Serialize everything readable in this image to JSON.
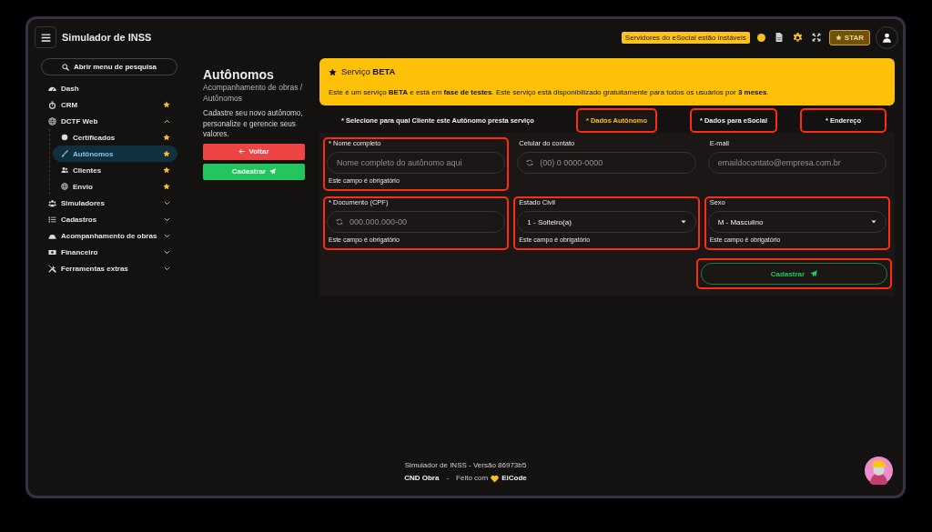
{
  "topbar": {
    "title": "Simulador de INSS",
    "status_message": "Servidores do eSocial estão instáveis",
    "star_button": "STAR"
  },
  "sidebar": {
    "search_button": "Abrir menu de pesquisa",
    "items": [
      {
        "label": "Dash",
        "kind": "link",
        "starred": false,
        "selected": false
      },
      {
        "label": "CRM",
        "kind": "link",
        "starred": true,
        "selected": false
      },
      {
        "label": "DCTF Web",
        "kind": "group",
        "expanded": true,
        "starred": false,
        "selected": false,
        "children": [
          {
            "label": "Certificados",
            "starred": true,
            "selected": false
          },
          {
            "label": "Autônomos",
            "starred": true,
            "selected": true
          },
          {
            "label": "Clientes",
            "starred": true,
            "selected": false
          },
          {
            "label": "Envio",
            "starred": true,
            "selected": false
          }
        ]
      },
      {
        "label": "Simuladores",
        "kind": "group",
        "expanded": false,
        "starred": false,
        "selected": false
      },
      {
        "label": "Cadastros",
        "kind": "group",
        "expanded": false,
        "starred": false,
        "selected": false
      },
      {
        "label": "Acompanhamento de obras",
        "kind": "group",
        "expanded": false,
        "starred": false,
        "selected": false
      },
      {
        "label": "Financeiro",
        "kind": "group",
        "expanded": false,
        "starred": false,
        "selected": false
      },
      {
        "label": "Ferramentas extras",
        "kind": "group",
        "expanded": false,
        "starred": false,
        "selected": false
      }
    ]
  },
  "page_header": {
    "title": "Autônomos",
    "breadcrumb": "Acompanhamento de obras / Autônomos",
    "description": "Cadastre seu novo autônomo, personalize e gerencie seus valores.",
    "buttons": [
      {
        "label": "Voltar",
        "kind": "back"
      },
      {
        "label": "Cadastrar",
        "kind": "submit"
      }
    ]
  },
  "banner": {
    "title": "Serviço **BETA**",
    "text": "Este é um serviço **BETA** e está em **fase de testes**. Este serviço está disponibilizado gratuitamente para todos os usuários por **3 meses**."
  },
  "tabs": [
    {
      "label": "* Selecione para qual Cliente este Autônomo presta serviço",
      "selected": false,
      "highlighted": false
    },
    {
      "label": "* Dados Autônomo",
      "selected": true,
      "highlighted": true
    },
    {
      "label": "* Dados para eSocial",
      "selected": false,
      "highlighted": true
    },
    {
      "label": "* Endereço",
      "selected": false,
      "highlighted": true
    }
  ],
  "form": {
    "fields": [
      {
        "label": "* Nome completo",
        "kind": "text",
        "placeholder": "Nome completo do autônomo aqui",
        "help": "Este campo é obrigatório",
        "highlighted": true
      },
      {
        "label": "Celular do contato",
        "kind": "masked",
        "placeholder": "(00) 0 0000-0000",
        "highlighted": false
      },
      {
        "label": "E-mail",
        "kind": "text",
        "placeholder": "emaildocontato@empresa.com.br",
        "highlighted": false
      },
      {
        "label": "* Documento (CPF)",
        "kind": "masked",
        "placeholder": "000.000.000-00",
        "help": "Este campo é obrigatório",
        "highlighted": true
      },
      {
        "label": "Estado Civil",
        "kind": "select",
        "value": "1 - Solteiro(a)",
        "help": "Este campo é obrigatório",
        "highlighted": true
      },
      {
        "label": "Sexo",
        "kind": "select",
        "value": "M - Masculino",
        "help": "Este campo é obrigatório",
        "highlighted": true
      }
    ],
    "submit": {
      "label": "Cadastrar",
      "highlighted": true
    }
  },
  "footer": {
    "version": "Simulador de INSS - Versão 86973b5",
    "brand": "CND Obra",
    "separator": "-",
    "made_with": "Feito com",
    "author": "EiCode"
  }
}
